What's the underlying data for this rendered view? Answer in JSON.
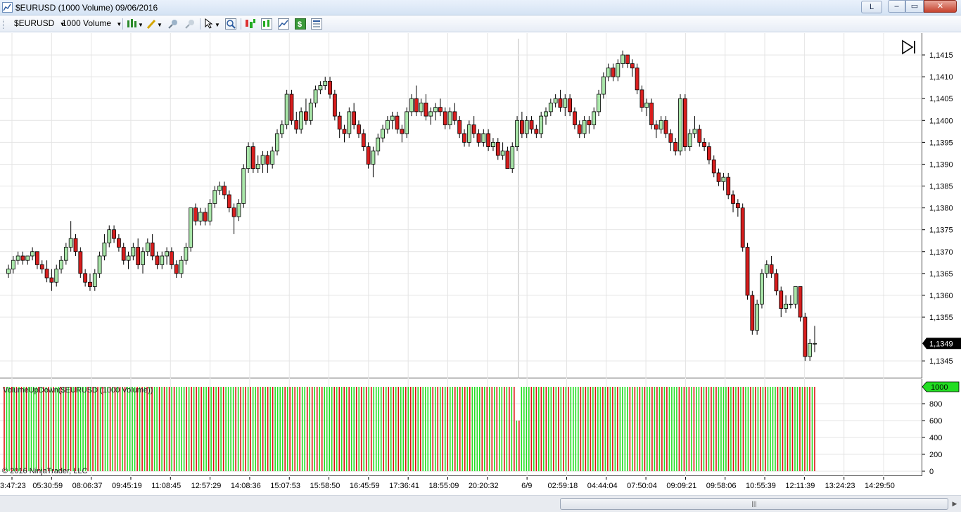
{
  "window": {
    "title": "$EURUSD (1000 Volume)  09/06/2016",
    "link_label": "L",
    "min_label": "–",
    "max_label": "▭",
    "close_label": "✕"
  },
  "toolbar": {
    "instrument": "$EURUSD",
    "interval": "1000 Volume",
    "icons": [
      "chart-style-icon",
      "pencil-draw-icon",
      "zoom-in-icon",
      "zoom-out-icon",
      "cursor-select-icon",
      "magnifier-icon",
      "strategies-icon",
      "indicators-icon",
      "trend-lines-icon",
      "money-icon",
      "properties-icon"
    ]
  },
  "colors": {
    "up_bar": "#a9e6a9",
    "down_bar": "#d81e1e",
    "volume_up": "#22dd22",
    "volume_down": "#dd1111",
    "grid": "#e4e4e4",
    "last_price_bg": "#000000",
    "volume_marker_bg": "#22dd22"
  },
  "price_axis": {
    "labels": [
      "1,1415",
      "1,1410",
      "1,1405",
      "1,1400",
      "1,1395",
      "1,1390",
      "1,1385",
      "1,1380",
      "1,1375",
      "1,1370",
      "1,1365",
      "1,1360",
      "1,1355",
      "1,1345"
    ],
    "last_price": "1,1349"
  },
  "volume_panel": {
    "indicator_label": "VolumeUpDown($EURUSD (1000 Volume))",
    "axis_labels": [
      "800",
      "600",
      "400",
      "200",
      "0"
    ],
    "marker": "1000",
    "copyright": "© 2016 NinjaTrader, LLC"
  },
  "time_axis": {
    "labels": [
      "3:47:23",
      "05:30:59",
      "08:06:37",
      "09:45:19",
      "11:08:45",
      "12:57:29",
      "14:08:36",
      "15:07:53",
      "15:58:50",
      "16:45:59",
      "17:36:41",
      "18:55:09",
      "20:20:32",
      "6/9",
      "02:59:18",
      "04:44:04",
      "07:50:04",
      "09:09:21",
      "09:58:06",
      "10:55:39",
      "12:11:39",
      "13:24:23",
      "14:29:50"
    ]
  },
  "chart_data": {
    "type": "candlestick",
    "instrument": "$EURUSD",
    "interval": "1000 Volume",
    "ylim": [
      1.1341,
      1.142
    ],
    "series": [
      {
        "name": "",
        "ohlc": [
          [
            1.1365,
            1.1367,
            1.1364,
            1.1366
          ],
          [
            1.1366,
            1.1369,
            1.1365,
            1.1368
          ],
          [
            1.1368,
            1.137,
            1.1367,
            1.1369
          ],
          [
            1.1369,
            1.137,
            1.1367,
            1.1368
          ],
          [
            1.1368,
            1.1369,
            1.1367,
            1.1369
          ],
          [
            1.1369,
            1.1371,
            1.1368,
            1.137
          ],
          [
            1.137,
            1.137,
            1.1366,
            1.1367
          ],
          [
            1.1367,
            1.1368,
            1.1365,
            1.1366
          ],
          [
            1.1366,
            1.1368,
            1.1363,
            1.1364
          ],
          [
            1.1364,
            1.1366,
            1.1361,
            1.1363
          ],
          [
            1.1363,
            1.1367,
            1.1362,
            1.1366
          ],
          [
            1.1366,
            1.1369,
            1.1365,
            1.1368
          ],
          [
            1.1368,
            1.1372,
            1.1367,
            1.1371
          ],
          [
            1.1371,
            1.1377,
            1.137,
            1.1373
          ],
          [
            1.1373,
            1.1374,
            1.1369,
            1.137
          ],
          [
            1.137,
            1.1371,
            1.1364,
            1.1365
          ],
          [
            1.1365,
            1.1366,
            1.1362,
            1.1363
          ],
          [
            1.1363,
            1.1365,
            1.1361,
            1.1362
          ],
          [
            1.1362,
            1.1366,
            1.1361,
            1.1365
          ],
          [
            1.1365,
            1.137,
            1.1364,
            1.1369
          ],
          [
            1.1369,
            1.1374,
            1.1368,
            1.1372
          ],
          [
            1.1372,
            1.1376,
            1.1371,
            1.1375
          ],
          [
            1.1375,
            1.1376,
            1.1372,
            1.1373
          ],
          [
            1.1373,
            1.1374,
            1.137,
            1.1371
          ],
          [
            1.1371,
            1.1372,
            1.1367,
            1.1368
          ],
          [
            1.1368,
            1.137,
            1.1366,
            1.1369
          ],
          [
            1.1369,
            1.1372,
            1.1368,
            1.1371
          ],
          [
            1.1371,
            1.1373,
            1.1366,
            1.1367
          ],
          [
            1.1367,
            1.1371,
            1.1365,
            1.137
          ],
          [
            1.137,
            1.1373,
            1.1369,
            1.1372
          ],
          [
            1.1372,
            1.1374,
            1.1368,
            1.1369
          ],
          [
            1.1369,
            1.137,
            1.1366,
            1.1367
          ],
          [
            1.1367,
            1.137,
            1.1366,
            1.1369
          ],
          [
            1.1369,
            1.1371,
            1.1367,
            1.137
          ],
          [
            1.137,
            1.1371,
            1.1366,
            1.1367
          ],
          [
            1.1367,
            1.1368,
            1.1364,
            1.1365
          ],
          [
            1.1365,
            1.1369,
            1.1364,
            1.1368
          ],
          [
            1.1368,
            1.1372,
            1.1367,
            1.1371
          ],
          [
            1.1371,
            1.138,
            1.137,
            1.138
          ],
          [
            1.138,
            1.1381,
            1.1376,
            1.1377
          ],
          [
            1.1377,
            1.138,
            1.1376,
            1.1379
          ],
          [
            1.1379,
            1.138,
            1.1376,
            1.1377
          ],
          [
            1.1377,
            1.1382,
            1.1376,
            1.1381
          ],
          [
            1.1381,
            1.1385,
            1.138,
            1.1384
          ],
          [
            1.1384,
            1.1386,
            1.1383,
            1.1385
          ],
          [
            1.1385,
            1.1386,
            1.1382,
            1.1383
          ],
          [
            1.1383,
            1.1384,
            1.1379,
            1.138
          ],
          [
            1.138,
            1.1381,
            1.1374,
            1.1378
          ],
          [
            1.1378,
            1.1382,
            1.1377,
            1.1381
          ],
          [
            1.1381,
            1.139,
            1.138,
            1.1389
          ],
          [
            1.1389,
            1.1395,
            1.1388,
            1.1394
          ],
          [
            1.1394,
            1.1395,
            1.1388,
            1.1389
          ],
          [
            1.1389,
            1.1392,
            1.1388,
            1.139
          ],
          [
            1.139,
            1.1393,
            1.1388,
            1.1392
          ],
          [
            1.1392,
            1.1393,
            1.1388,
            1.139
          ],
          [
            1.139,
            1.1394,
            1.1389,
            1.1393
          ],
          [
            1.1393,
            1.1398,
            1.1392,
            1.1397
          ],
          [
            1.1397,
            1.14,
            1.1396,
            1.1399
          ],
          [
            1.1399,
            1.1407,
            1.1398,
            1.1406
          ],
          [
            1.1406,
            1.1407,
            1.1399,
            1.14
          ],
          [
            1.14,
            1.1402,
            1.1397,
            1.1398
          ],
          [
            1.1398,
            1.1403,
            1.1397,
            1.1402
          ],
          [
            1.1402,
            1.1405,
            1.1399,
            1.14
          ],
          [
            1.14,
            1.1405,
            1.1399,
            1.1404
          ],
          [
            1.1404,
            1.1408,
            1.1403,
            1.1407
          ],
          [
            1.1407,
            1.1409,
            1.1406,
            1.1408
          ],
          [
            1.1408,
            1.141,
            1.1407,
            1.1409
          ],
          [
            1.1409,
            1.141,
            1.1405,
            1.1406
          ],
          [
            1.1406,
            1.1407,
            1.14,
            1.1401
          ],
          [
            1.1401,
            1.1402,
            1.1396,
            1.1398
          ],
          [
            1.1398,
            1.1399,
            1.1395,
            1.1397
          ],
          [
            1.1397,
            1.1403,
            1.1396,
            1.1402
          ],
          [
            1.1402,
            1.1404,
            1.1398,
            1.1399
          ],
          [
            1.1399,
            1.14,
            1.1396,
            1.1397
          ],
          [
            1.1397,
            1.1398,
            1.1393,
            1.1394
          ],
          [
            1.1394,
            1.1395,
            1.1389,
            1.139
          ],
          [
            1.139,
            1.1394,
            1.1387,
            1.1393
          ],
          [
            1.1393,
            1.1397,
            1.1392,
            1.1396
          ],
          [
            1.1396,
            1.1399,
            1.1395,
            1.1398
          ],
          [
            1.1398,
            1.1401,
            1.1397,
            1.14
          ],
          [
            1.14,
            1.1402,
            1.1398,
            1.1401
          ],
          [
            1.1401,
            1.1402,
            1.1397,
            1.1398
          ],
          [
            1.1398,
            1.1399,
            1.1395,
            1.1397
          ],
          [
            1.1397,
            1.1403,
            1.1396,
            1.1402
          ],
          [
            1.1402,
            1.1406,
            1.1401,
            1.1405
          ],
          [
            1.1405,
            1.1408,
            1.1401,
            1.1402
          ],
          [
            1.1402,
            1.1405,
            1.1401,
            1.1404
          ],
          [
            1.1404,
            1.1406,
            1.14,
            1.1401
          ],
          [
            1.1401,
            1.1403,
            1.1399,
            1.1402
          ],
          [
            1.1402,
            1.1404,
            1.14,
            1.1403
          ],
          [
            1.1403,
            1.1405,
            1.1401,
            1.1402
          ],
          [
            1.1402,
            1.1403,
            1.1398,
            1.1399
          ],
          [
            1.1399,
            1.1403,
            1.1398,
            1.1402
          ],
          [
            1.1402,
            1.1404,
            1.1399,
            1.14
          ],
          [
            1.14,
            1.1401,
            1.1396,
            1.1397
          ],
          [
            1.1397,
            1.1398,
            1.1394,
            1.1395
          ],
          [
            1.1395,
            1.14,
            1.1394,
            1.1399
          ],
          [
            1.1399,
            1.1401,
            1.1396,
            1.1397
          ],
          [
            1.1397,
            1.1398,
            1.1394,
            1.1395
          ],
          [
            1.1395,
            1.1398,
            1.1394,
            1.1397
          ],
          [
            1.1397,
            1.1398,
            1.1393,
            1.1394
          ],
          [
            1.1394,
            1.1396,
            1.1393,
            1.1395
          ],
          [
            1.1395,
            1.1396,
            1.1391,
            1.1392
          ],
          [
            1.1392,
            1.1395,
            1.1391,
            1.1393
          ],
          [
            1.1393,
            1.1394,
            1.1389,
            1.1389
          ],
          [
            1.1389,
            1.1395,
            1.1388,
            1.1394
          ],
          [
            1.1394,
            1.1401,
            1.1393,
            1.14
          ],
          [
            1.14,
            1.1402,
            1.1396,
            1.1397
          ],
          [
            1.1397,
            1.1401,
            1.1396,
            1.14
          ],
          [
            1.14,
            1.1401,
            1.1397,
            1.1398
          ],
          [
            1.1398,
            1.1399,
            1.1396,
            1.1397
          ],
          [
            1.1397,
            1.1402,
            1.1396,
            1.1401
          ],
          [
            1.1401,
            1.1403,
            1.1399,
            1.1402
          ],
          [
            1.1402,
            1.1405,
            1.1401,
            1.1404
          ],
          [
            1.1404,
            1.1406,
            1.1403,
            1.1405
          ],
          [
            1.1405,
            1.1407,
            1.1402,
            1.1403
          ],
          [
            1.1403,
            1.1406,
            1.1401,
            1.1405
          ],
          [
            1.1405,
            1.1406,
            1.1401,
            1.1402
          ],
          [
            1.1402,
            1.1403,
            1.1398,
            1.1399
          ],
          [
            1.1399,
            1.14,
            1.1396,
            1.1397
          ],
          [
            1.1397,
            1.1401,
            1.1396,
            1.14
          ],
          [
            1.14,
            1.1401,
            1.1397,
            1.1399
          ],
          [
            1.1399,
            1.1403,
            1.1398,
            1.1402
          ],
          [
            1.1402,
            1.1407,
            1.1401,
            1.1406
          ],
          [
            1.1406,
            1.1411,
            1.1405,
            1.141
          ],
          [
            1.141,
            1.1413,
            1.1409,
            1.1412
          ],
          [
            1.1412,
            1.1413,
            1.1409,
            1.141
          ],
          [
            1.141,
            1.1414,
            1.1409,
            1.1413
          ],
          [
            1.1413,
            1.1416,
            1.1412,
            1.1415
          ],
          [
            1.1415,
            1.1415,
            1.1412,
            1.1413
          ],
          [
            1.1413,
            1.1414,
            1.141,
            1.1412
          ],
          [
            1.1412,
            1.1413,
            1.1406,
            1.1407
          ],
          [
            1.1407,
            1.1408,
            1.1402,
            1.1403
          ],
          [
            1.1403,
            1.1405,
            1.1401,
            1.1404
          ],
          [
            1.1404,
            1.1405,
            1.1398,
            1.1399
          ],
          [
            1.1399,
            1.14,
            1.1396,
            1.1398
          ],
          [
            1.1398,
            1.1401,
            1.1397,
            1.14
          ],
          [
            1.14,
            1.1401,
            1.1396,
            1.1397
          ],
          [
            1.1397,
            1.1398,
            1.1393,
            1.1395
          ],
          [
            1.1395,
            1.1396,
            1.1392,
            1.1393
          ],
          [
            1.1393,
            1.1406,
            1.1392,
            1.1405
          ],
          [
            1.1405,
            1.1406,
            1.1393,
            1.1394
          ],
          [
            1.1394,
            1.1398,
            1.1393,
            1.1397
          ],
          [
            1.1397,
            1.1401,
            1.1396,
            1.1398
          ],
          [
            1.1398,
            1.1399,
            1.1394,
            1.1395
          ],
          [
            1.1395,
            1.1396,
            1.1393,
            1.1394
          ],
          [
            1.1394,
            1.1395,
            1.139,
            1.1391
          ],
          [
            1.1391,
            1.1392,
            1.1387,
            1.1388
          ],
          [
            1.1388,
            1.1389,
            1.1385,
            1.1386
          ],
          [
            1.1386,
            1.1388,
            1.1384,
            1.1387
          ],
          [
            1.1387,
            1.1388,
            1.1382,
            1.1383
          ],
          [
            1.1383,
            1.1384,
            1.1379,
            1.1381
          ],
          [
            1.1381,
            1.1382,
            1.1378,
            1.138
          ],
          [
            1.138,
            1.1381,
            1.137,
            1.1371
          ],
          [
            1.1371,
            1.1372,
            1.1359,
            1.136
          ],
          [
            1.136,
            1.1361,
            1.1351,
            1.1352
          ],
          [
            1.1352,
            1.1359,
            1.1351,
            1.1358
          ],
          [
            1.1358,
            1.1366,
            1.1357,
            1.1365
          ],
          [
            1.1365,
            1.1368,
            1.1364,
            1.1367
          ],
          [
            1.1367,
            1.1369,
            1.1364,
            1.1365
          ],
          [
            1.1365,
            1.1366,
            1.136,
            1.1361
          ],
          [
            1.1361,
            1.1362,
            1.1355,
            1.1357
          ],
          [
            1.1357,
            1.136,
            1.1356,
            1.1358
          ],
          [
            1.1358,
            1.136,
            1.1357,
            1.1358
          ],
          [
            1.1358,
            1.1362,
            1.1357,
            1.1362
          ],
          [
            1.1362,
            1.1362,
            1.1354,
            1.1355
          ],
          [
            1.1355,
            1.1356,
            1.1345,
            1.1346
          ],
          [
            1.1346,
            1.135,
            1.1345,
            1.1349
          ],
          [
            1.1349,
            1.1353,
            1.1347,
            1.1349
          ]
        ]
      }
    ],
    "volume": {
      "bar_size": 1000,
      "pattern": "alternating up/down volume bars, each 1000 contracts; one partial bar near 6/9 at ~600"
    }
  }
}
